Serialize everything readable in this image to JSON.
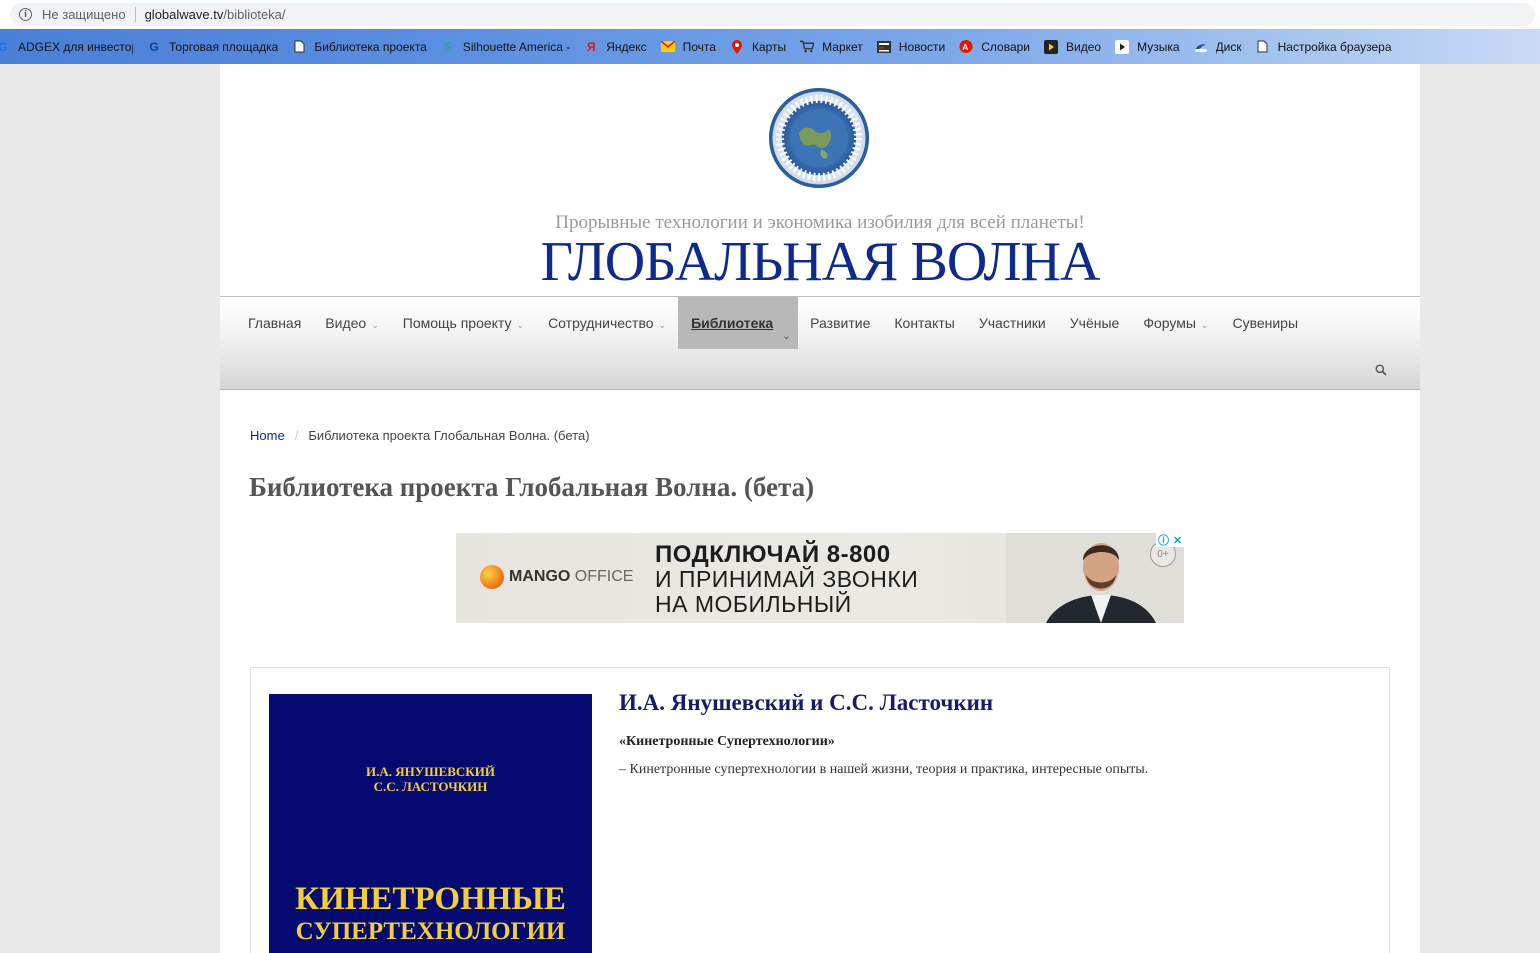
{
  "browser": {
    "security_text": "Не защищено",
    "url_host": "globalwave.tv",
    "url_path": "/biblioteka/"
  },
  "bookmarks": [
    {
      "label": "ADGEX для инвестор",
      "icon": "g-icon"
    },
    {
      "label": "Торговая площадка",
      "icon": "google-icon"
    },
    {
      "label": "Библиотека проекта",
      "icon": "page-icon"
    },
    {
      "label": "Silhouette America -",
      "icon": "silhouette-icon"
    },
    {
      "label": "Яндекс",
      "icon": "yandex-icon"
    },
    {
      "label": "Почта",
      "icon": "mail-icon"
    },
    {
      "label": "Карты",
      "icon": "maps-icon"
    },
    {
      "label": "Маркет",
      "icon": "cart-icon"
    },
    {
      "label": "Новости",
      "icon": "news-icon"
    },
    {
      "label": "Словари",
      "icon": "dictionary-icon"
    },
    {
      "label": "Видео",
      "icon": "video-icon"
    },
    {
      "label": "Музыка",
      "icon": "music-icon"
    },
    {
      "label": "Диск",
      "icon": "disk-icon"
    },
    {
      "label": "Настройка браузера",
      "icon": "page-icon"
    }
  ],
  "header": {
    "logo_alt": "ГЛОБАЛЬНАЯ ВОЛНА ПРОРЫВНЫЕ ТЕХНОЛОГИИ",
    "tagline": "Прорывные технологии и экономика изобилия для всей планеты!",
    "site_title": "ГЛОБАЛЬНАЯ ВОЛНА"
  },
  "nav": {
    "items": [
      {
        "label": "Главная",
        "dropdown": false
      },
      {
        "label": "Видео",
        "dropdown": true
      },
      {
        "label": "Помощь проекту",
        "dropdown": true
      },
      {
        "label": "Сотрудничество",
        "dropdown": true
      },
      {
        "label": "Библиотека",
        "dropdown": true,
        "active": true
      },
      {
        "label": "Развитие",
        "dropdown": false
      },
      {
        "label": "Контакты",
        "dropdown": false
      },
      {
        "label": "Участники",
        "dropdown": false
      },
      {
        "label": "Учёные",
        "dropdown": false
      },
      {
        "label": "Форумы",
        "dropdown": true
      },
      {
        "label": "Сувениры",
        "dropdown": false
      }
    ]
  },
  "breadcrumb": {
    "home": "Home",
    "current": "Библиотека проекта Глобальная Волна. (бета)"
  },
  "page_title": "Библиотека проекта Глобальная Волна. (бета)",
  "ad": {
    "brand_bold": "MANGO",
    "brand_light": " OFFICE",
    "line1": "ПОДКЛЮЧАЙ 8-800",
    "line2": "И ПРИНИМАЙ ЗВОНКИ",
    "line3": "НА  МОБИЛЬНЫЙ",
    "age": "0+",
    "colors": {
      "accent": "#f28c1e",
      "background": "#e9e7e1"
    }
  },
  "book": {
    "cover_authors_line1": "И.А. ЯНУШЕВСКИЙ",
    "cover_authors_line2": "С.С. ЛАСТОЧКИН",
    "cover_title1": "КИНЕТРОННЫЕ",
    "cover_title2": "СУПЕРТЕХНОЛОГИИ",
    "authors": "И.А. Янушевский и С.С. Ласточкин",
    "name": "«Кинетронные Супертехнологии»",
    "description": "– Кинетронные супертехнологии в нашей жизни, теория и практика, интересные опыты.",
    "colors": {
      "cover": "#050a70",
      "cover_text": "#f2cf3a"
    }
  }
}
